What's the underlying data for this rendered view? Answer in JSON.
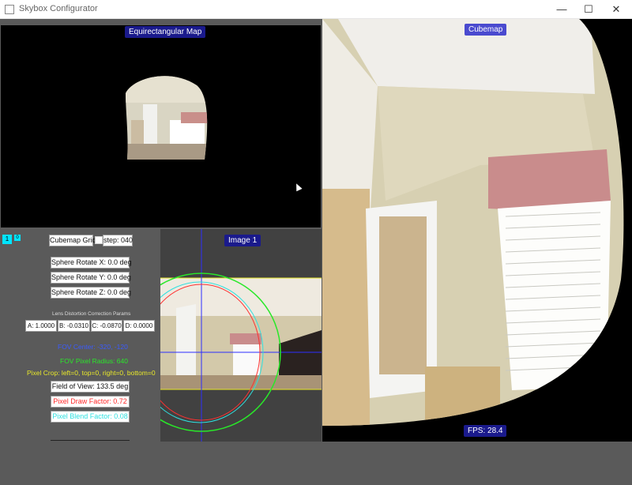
{
  "window": {
    "title": "Skybox Configurator",
    "minimize_glyph": "—",
    "maximize_glyph": "☐",
    "close_glyph": "✕"
  },
  "equirect": {
    "label": "Equirectangular Map"
  },
  "cubemap": {
    "label": "Cubemap",
    "fps": "FPS: 28.4"
  },
  "image_panel": {
    "label": "Image 1"
  },
  "controls": {
    "image_tab_1": "1",
    "image_tab_2": "0",
    "cubemap_grid_label": "Cubemap Grid",
    "step_label": "step: 040",
    "sphere_x": "Sphere Rotate X: 0.0 deg",
    "sphere_y": "Sphere Rotate Y: 0.0 deg",
    "sphere_z": "Sphere Rotate Z: 0.0 deg",
    "lens_title": "Lens Distortion Correction Params",
    "lens_a": "A: 1.0000",
    "lens_b": "B: -0.0310",
    "lens_c": "C: -0.0870",
    "lens_d": "D: 0.0000",
    "fov_center": "FOV Center: -320, -120",
    "fov_radius": "FOV Pixel Radius: 640",
    "pixel_crop": "Pixel Crop: left=0, top=0, right=0, bottom=0",
    "field_of_view": "Field of View: 133.5 deg",
    "draw_factor": "Pixel Draw Factor: 0.72",
    "blend_factor": "Pixel Blend Factor: 0.08"
  },
  "colors": {
    "accent_cyan": "#00e5ff",
    "fov_center_blue": "#3b5bff",
    "fov_radius_green": "#29e829",
    "pixel_crop_yellow": "#e8e82a",
    "draw_factor_red": "#ff2a2a",
    "blend_factor_cyan": "#2ee0e0"
  }
}
